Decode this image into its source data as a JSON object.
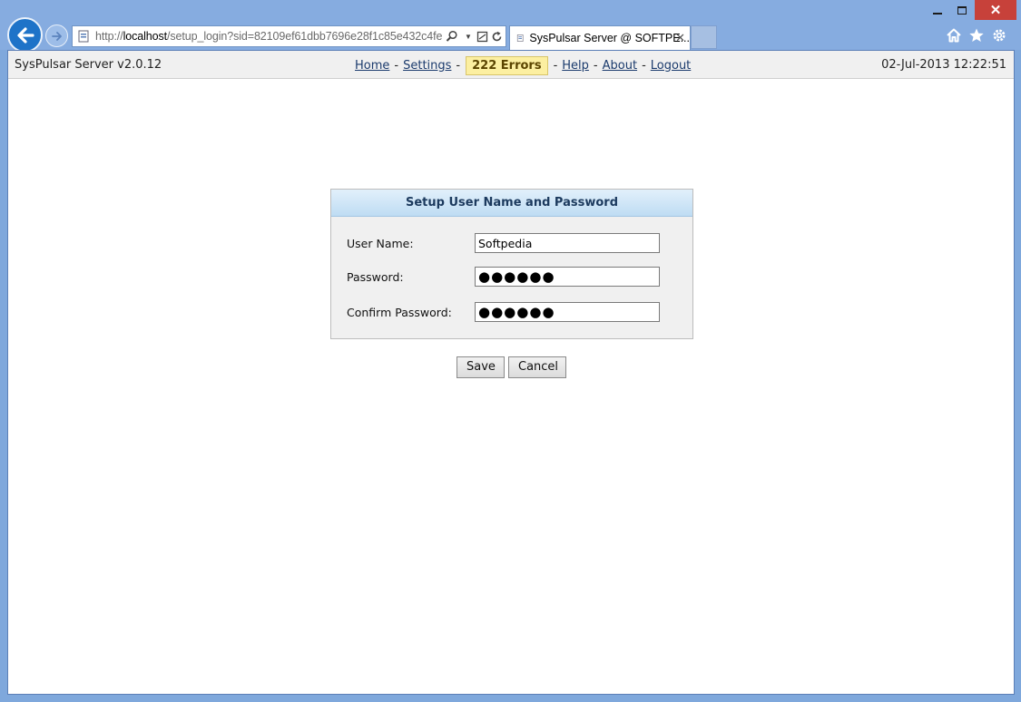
{
  "browser": {
    "address_scheme": "http://",
    "address_host": "localhost",
    "address_path": "/setup_login?sid=82109ef61dbb7696e28f1c85e432c4fe",
    "tab_title": "SysPulsar Server @ SOFTPE...",
    "icons": [
      "back-icon",
      "forward-icon",
      "search-icon",
      "compat-icon",
      "refresh-icon",
      "home-icon",
      "favorites-icon",
      "tools-icon"
    ]
  },
  "header": {
    "app_title": "SysPulsar Server v2.0.12",
    "nav": {
      "home": "Home",
      "settings": "Settings",
      "errors": "222 Errors",
      "help": "Help",
      "about": "About",
      "logout": "Logout",
      "separator": "-"
    },
    "datetime": "02-Jul-2013 12:22:51"
  },
  "setup": {
    "title": "Setup User Name and Password",
    "username_label": "User Name:",
    "username_value": "Softpedia",
    "password_label": "Password:",
    "password_value": "●●●●●●",
    "confirm_label": "Confirm Password:",
    "confirm_value": "●●●●●●"
  },
  "buttons": {
    "save": "Save",
    "cancel": "Cancel"
  },
  "colors": {
    "errors_badge_bg": "#fcefa1",
    "panel_header": "#bedcf3",
    "chrome": "#86ace0"
  }
}
